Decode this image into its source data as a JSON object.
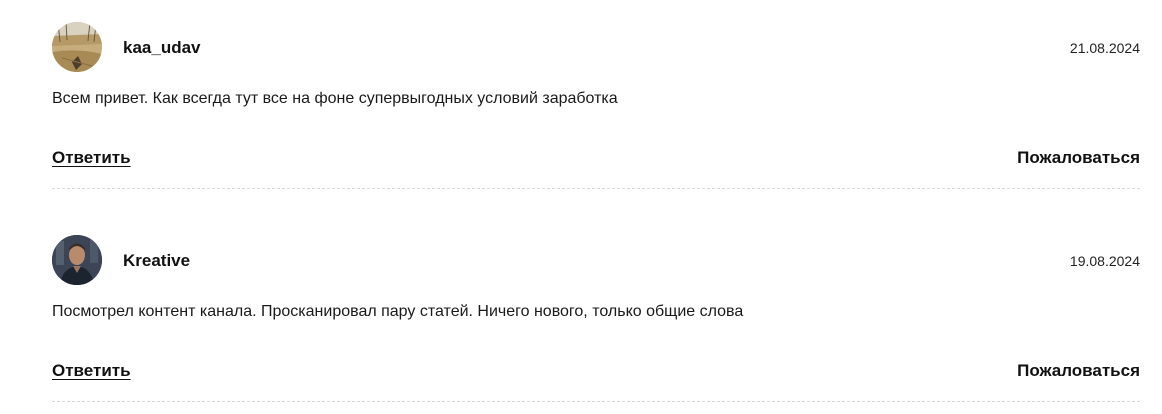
{
  "comments": [
    {
      "author": "kaa_udav",
      "date": "21.08.2024",
      "text": "Всем привет. Как всегда тут все на фоне супервыгодных условий заработка",
      "reply_label": "Ответить",
      "report_label": "Пожаловаться",
      "avatar_icon": "landscape-photo-avatar"
    },
    {
      "author": "Kreative",
      "date": "19.08.2024",
      "text": "Посмотрел контент канала. Просканировал пару статей. Ничего нового, только общие слова",
      "reply_label": "Ответить",
      "report_label": "Пожаловаться",
      "avatar_icon": "person-photo-avatar"
    }
  ]
}
